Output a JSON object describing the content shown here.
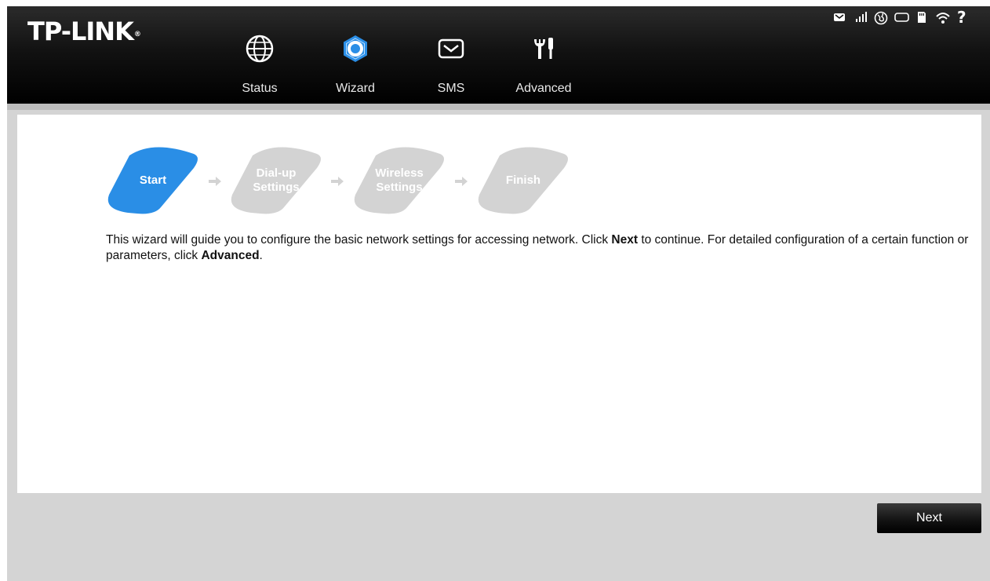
{
  "brand": {
    "logo_text": "TP-LINK",
    "trademark": "®"
  },
  "nav": {
    "items": [
      {
        "label": "Status",
        "icon": "globe-icon",
        "active": false
      },
      {
        "label": "Wizard",
        "icon": "gear-icon",
        "active": true
      },
      {
        "label": "SMS",
        "icon": "envelope-icon",
        "active": false
      },
      {
        "label": "Advanced",
        "icon": "tools-icon",
        "active": false
      }
    ]
  },
  "status_bar": {
    "icons": [
      "message-icon",
      "signal-icon",
      "internet-icon",
      "battery-icon",
      "sd-card-icon",
      "wifi-icon",
      "help-icon"
    ],
    "help_label": "?"
  },
  "wizard": {
    "steps": [
      {
        "line1": "Start",
        "line2": "",
        "active": true
      },
      {
        "line1": "Dial-up",
        "line2": "Settings",
        "active": false
      },
      {
        "line1": "Wireless",
        "line2": "Settings",
        "active": false
      },
      {
        "line1": "Finish",
        "line2": "",
        "active": false
      }
    ],
    "description": {
      "part1": "This wizard will guide you to configure the basic network settings for accessing network. Click ",
      "next_word": "Next",
      "part2": " to continue. For detailed configuration of a certain function or parameters, click ",
      "advanced_word": "Advanced",
      "part3": "."
    }
  },
  "footer": {
    "next_label": "Next"
  },
  "colors": {
    "accent": "#2a8ee6",
    "step_inactive": "#d3d3d3",
    "header_bg": "#121212"
  }
}
